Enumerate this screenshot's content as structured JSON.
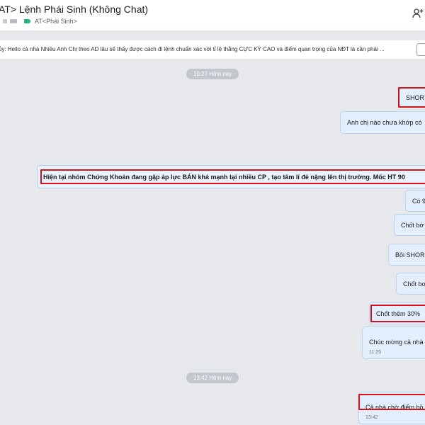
{
  "header": {
    "title": "AT>   Lệnh Phái Sinh (Không Chat)",
    "tag_label": "AT<Phái Sinh>",
    "add_member_icon": "add-member-icon"
  },
  "pinned": {
    "text": "ủy: Hello cả nhà Nhiều Anh Chị theo AD lâu sẽ thấy được cách đi lệnh chuẩn xác với tỉ lệ thắng CỰC KỲ CAO và điểm quan trọng của NĐT là cần phải ..."
  },
  "time_separators": {
    "first": "10:27 Hôm nay",
    "second": "13:42 Hôm nay"
  },
  "messages": {
    "m1": "SHOR",
    "m2": "Anh chị nào chưa khớp có",
    "m3": "Hiện tại nhóm Chứng Khoán đang gặp áp lực BÁN khá mạnh tại nhiều CP , tạo tâm lí đè nặng lên thị trường. Mốc HT 90",
    "m4": "Có 9",
    "m5": "Chốt bớ",
    "m6": "Bồi SHOR",
    "m7": "Chốt bơ",
    "m8": "Chốt thêm 30%",
    "m9": "Chúc mừng cả nhà",
    "m9_time": "11:25",
    "m10": "Cả nhà chờ điểm bồ",
    "m10_time": "13:42"
  },
  "colors": {
    "highlight": "#d8121a",
    "bubble": "#e3effd",
    "background": "#e6e8ec"
  }
}
